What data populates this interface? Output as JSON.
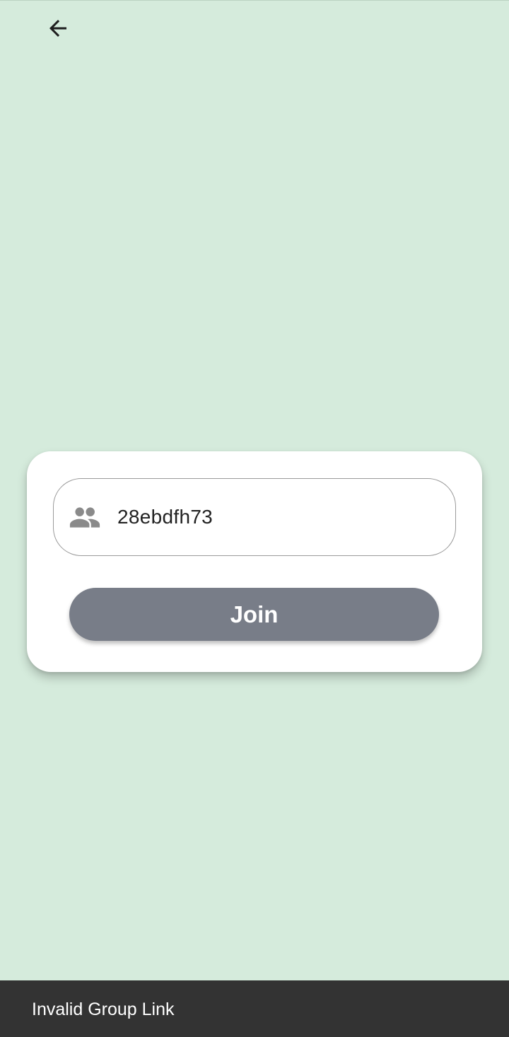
{
  "header": {
    "back_icon": "arrow-left-icon"
  },
  "join_card": {
    "input": {
      "icon": "group-icon",
      "value": "28ebdfh73"
    },
    "join_label": "Join"
  },
  "snackbar": {
    "message": "Invalid Group Link"
  },
  "colors": {
    "background": "#d5ebdc",
    "card": "#ffffff",
    "button": "#787d88",
    "snackbar": "#333333"
  }
}
